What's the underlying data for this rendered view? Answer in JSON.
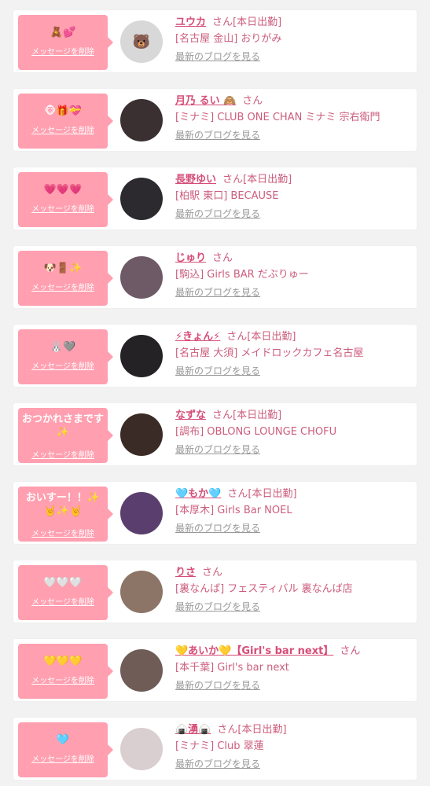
{
  "items": [
    {
      "message": "🧸💕",
      "delete_label": "メッセージを削除",
      "name": "ユウカ",
      "san": "さん",
      "status": "[本日出勤]",
      "shop": "[名古屋 金山] おりがみ",
      "blog_link": "最新のブログを見る",
      "avatar_icon": "bear-cartoon-icon",
      "avatar_color": "#d8d8d8"
    },
    {
      "message": "🐵🎁💝",
      "delete_label": "メッセージを削除",
      "name": "月乃 るい 🙈",
      "san": "さん",
      "status": "",
      "shop": "[ミナミ] CLUB ONE CHAN ミナミ 宗右衛門",
      "blog_link": "最新のブログを見る",
      "avatar_icon": "portrait-photo-icon",
      "avatar_color": "#3a3032"
    },
    {
      "message": "💗💗💗",
      "delete_label": "メッセージを削除",
      "name": "長野ゆい",
      "san": "さん",
      "status": "[本日出勤]",
      "shop": "[柏駅 東口] BECAUSE",
      "blog_link": "最新のブログを見る",
      "avatar_icon": "portrait-photo-icon",
      "avatar_color": "#2c2a2e"
    },
    {
      "message": "🐶🚪✨",
      "delete_label": "メッセージを削除",
      "name": "じゅり",
      "san": "さん",
      "status": "",
      "shop": "[駒込] Girls BAR だぶりゅー",
      "blog_link": "最新のブログを見る",
      "avatar_icon": "portrait-photo-icon",
      "avatar_color": "#6d5a66"
    },
    {
      "message": "🐰🩶",
      "delete_label": "メッセージを削除",
      "name": "⚡きょん⚡",
      "san": "さん",
      "status": "[本日出勤]",
      "shop": "[名古屋 大須] メイドロックカフェ名古屋",
      "blog_link": "最新のブログを見る",
      "avatar_icon": "portrait-photo-icon",
      "avatar_color": "#252225"
    },
    {
      "message": "おつかれさまです\n✨",
      "delete_label": "メッセージを削除",
      "name": "なずな",
      "san": "さん",
      "status": "[本日出勤]",
      "shop": "[調布] OBLONG LOUNGE CHOFU",
      "blog_link": "最新のブログを見る",
      "avatar_icon": "portrait-photo-icon",
      "avatar_color": "#3b2b26"
    },
    {
      "message": "おいすー！！✨\n🤘✨🤘",
      "delete_label": "メッセージを削除",
      "name": "🩵もか🩵",
      "san": "さん",
      "status": "[本日出勤]",
      "shop": "[本厚木] Girls Bar NOEL",
      "blog_link": "最新のブログを見る",
      "avatar_icon": "portrait-photo-icon",
      "avatar_color": "#5a3f6e"
    },
    {
      "message": "🤍🤍🤍",
      "delete_label": "メッセージを削除",
      "name": "りさ",
      "san": "さん",
      "status": "",
      "shop": "[裏なんば] フェスティバル 裏なんば店",
      "blog_link": "最新のブログを見る",
      "avatar_icon": "portrait-photo-icon",
      "avatar_color": "#8c7566"
    },
    {
      "message": "💛💛💛",
      "delete_label": "メッセージを削除",
      "name": "💛あいか💛【Girl's bar next】",
      "san": "さん",
      "status": "",
      "shop": "[本千葉] Girl's bar next",
      "blog_link": "最新のブログを見る",
      "avatar_icon": "portrait-photo-icon",
      "avatar_color": "#6f5c57"
    },
    {
      "message": "🩵",
      "delete_label": "メッセージを削除",
      "name": "🍙湧🍙",
      "san": "さん",
      "status": "[本日出勤]",
      "shop": "[ミナミ] Club 翠蓮",
      "blog_link": "最新のブログを見る",
      "avatar_icon": "portrait-photo-icon",
      "avatar_color": "#d9cfd0"
    }
  ]
}
